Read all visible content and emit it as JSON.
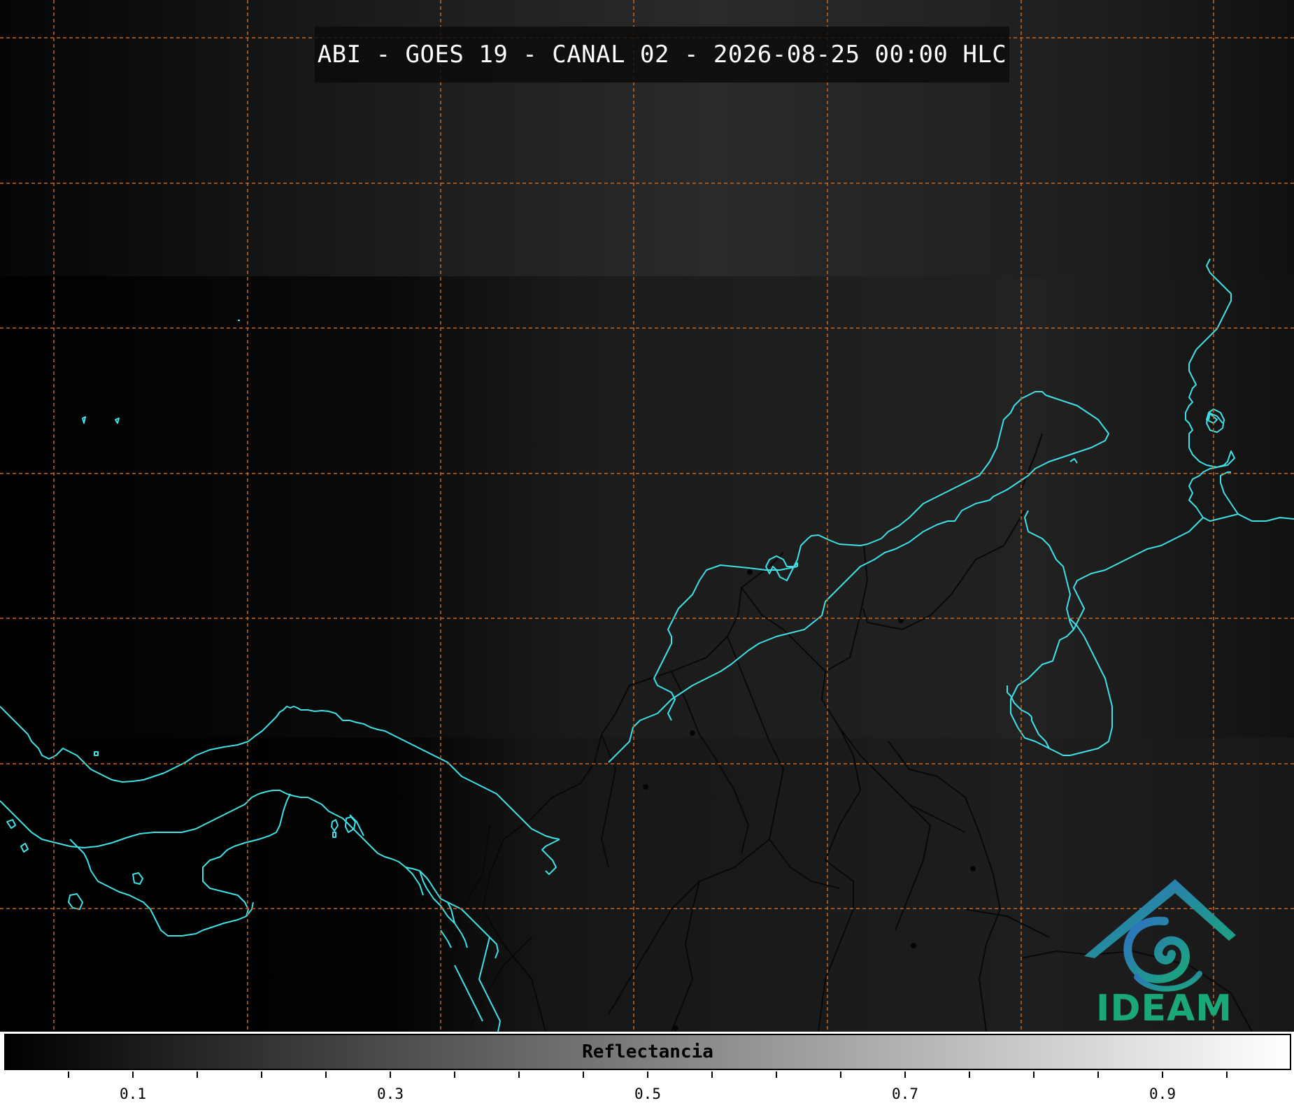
{
  "header": {
    "title": "ABI - GOES 19 - CANAL 02 - 2026-08-25 00:00 HLC"
  },
  "map": {
    "coastline_color": "#3fe0e6",
    "grid_color": "#c8661c",
    "border_color": "#0a0a0a"
  },
  "colorbar": {
    "label": "Reflectancia",
    "tick_labels": [
      "0.1",
      "0.3",
      "0.5",
      "0.7",
      "0.9"
    ],
    "tick_values": [
      0.1,
      0.3,
      0.5,
      0.7,
      0.9
    ],
    "range": [
      0.0,
      1.0
    ],
    "colormap": [
      "#000000",
      "#ffffff"
    ]
  },
  "logo": {
    "text": "IDEAM",
    "icon": "ideam-spiral-house-logo",
    "color": "#1aa87a"
  }
}
